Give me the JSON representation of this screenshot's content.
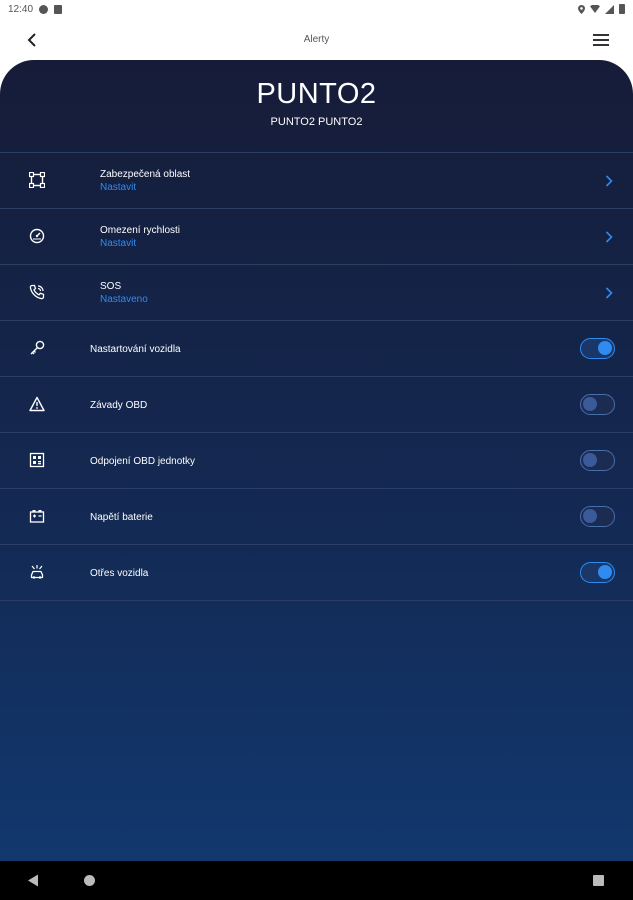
{
  "status_bar": {
    "time": "12:40"
  },
  "app_bar": {
    "title": "Alerty"
  },
  "vehicle": {
    "name": "PUNTO2",
    "subtitle": "PUNTO2 PUNTO2"
  },
  "nav_rows": [
    {
      "label": "Zabezpečená oblast",
      "status": "Nastavit",
      "icon": "area-frame-icon"
    },
    {
      "label": "Omezení rychlosti",
      "status": "Nastavit",
      "icon": "speedometer-icon"
    },
    {
      "label": "SOS",
      "status": "Nastaveno",
      "icon": "phone-call-icon"
    }
  ],
  "toggle_rows": [
    {
      "label": "Nastartování vozidla",
      "on": true,
      "icon": "key-icon"
    },
    {
      "label": "Závady OBD",
      "on": false,
      "icon": "warning-triangle-icon"
    },
    {
      "label": "Odpojení OBD jednotky",
      "on": false,
      "icon": "obd-unit-icon"
    },
    {
      "label": "Napětí baterie",
      "on": false,
      "icon": "battery-icon"
    },
    {
      "label": "Otřes vozidla",
      "on": true,
      "icon": "car-shake-icon"
    }
  ],
  "colors": {
    "accent": "#2f8bf0",
    "panel_top": "#161c38",
    "panel_bottom": "#12386e",
    "divider": "#2c3e66"
  }
}
